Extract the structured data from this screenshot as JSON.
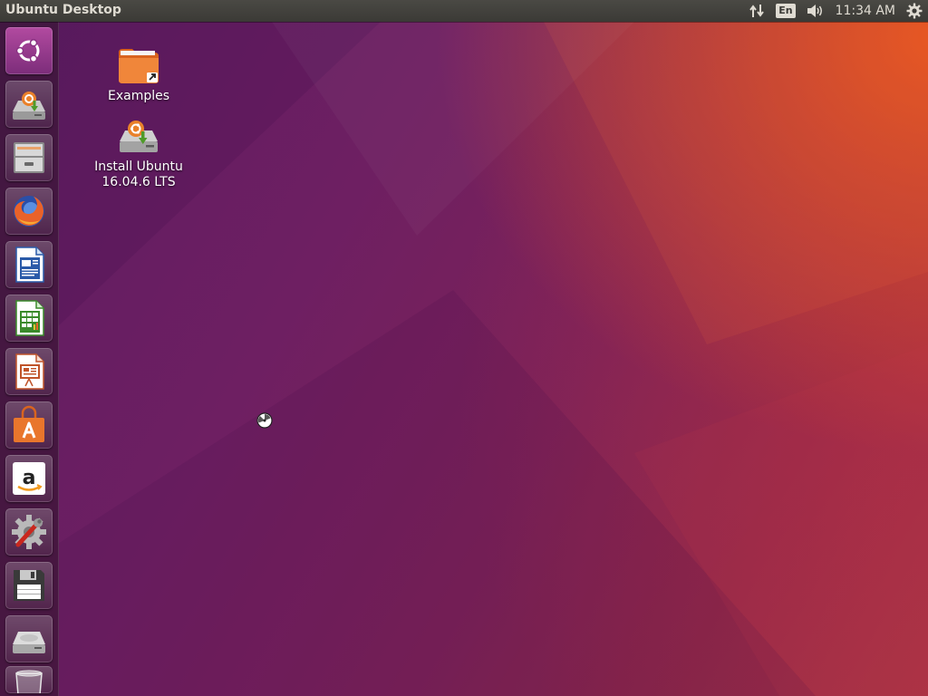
{
  "top_panel": {
    "app_title": "Ubuntu Desktop",
    "keyboard_layout": "En",
    "clock": "11:34 AM",
    "icons": [
      "network-icon",
      "keyboard-layout-indicator",
      "volume-icon",
      "system-gear-icon"
    ]
  },
  "launcher": {
    "items": [
      {
        "name": "dash-home",
        "icon": "ubuntu-logo-icon"
      },
      {
        "name": "install-ubuntu",
        "icon": "installer-drive-icon"
      },
      {
        "name": "files",
        "icon": "file-cabinet-icon"
      },
      {
        "name": "firefox",
        "icon": "firefox-icon"
      },
      {
        "name": "libreoffice-writer",
        "icon": "writer-document-icon"
      },
      {
        "name": "libreoffice-calc",
        "icon": "calc-spreadsheet-icon"
      },
      {
        "name": "libreoffice-impress",
        "icon": "impress-presentation-icon"
      },
      {
        "name": "ubuntu-software",
        "icon": "shopping-bag-icon"
      },
      {
        "name": "amazon",
        "icon": "amazon-icon"
      },
      {
        "name": "system-settings",
        "icon": "settings-wrench-gear-icon"
      },
      {
        "name": "floppy-drive",
        "icon": "floppy-disk-icon"
      },
      {
        "name": "hard-drive",
        "icon": "hard-drive-icon"
      },
      {
        "name": "trash",
        "icon": "trash-icon"
      }
    ]
  },
  "desktop": {
    "icons": [
      {
        "label": "Examples",
        "icon": "folder-link-icon"
      },
      {
        "label_line1": "Install Ubuntu",
        "label_line2": "16.04.6 LTS",
        "icon": "installer-drive-icon"
      }
    ]
  },
  "colors": {
    "panel_bg": "#3b3a36",
    "panel_text": "#dfdbd2",
    "wallpaper_purple": "#6e1f62",
    "wallpaper_orange": "#e9582a",
    "dash_accent": "#9b3c8f"
  }
}
